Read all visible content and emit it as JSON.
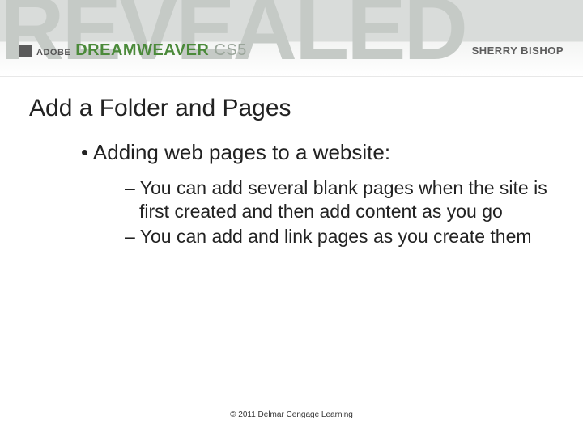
{
  "banner": {
    "bgword": "REVEALED",
    "adobe": "ADOBE",
    "product": "DREAMWEAVER",
    "version": "CS5",
    "author": "SHERRY BISHOP"
  },
  "slide": {
    "title": "Add a Folder and Pages",
    "l1": "Adding web pages to a website:",
    "l2a": "You can add several blank pages when the site is first created and then add content as you go",
    "l2b": "You can add and link pages as you create them"
  },
  "footer": "© 2011 Delmar Cengage Learning"
}
